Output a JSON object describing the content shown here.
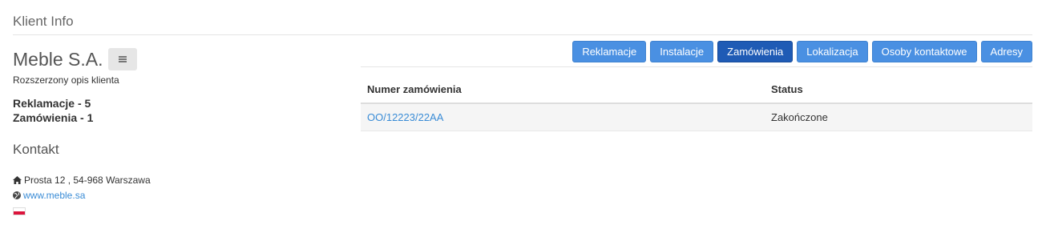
{
  "page": {
    "title": "Klient Info"
  },
  "client": {
    "name": "Meble S.A.",
    "description": "Rozszerzony opis klienta",
    "complaints_count": "Reklamacje - 5",
    "orders_count": "Zamówienia - 1"
  },
  "contact": {
    "heading": "Kontakt",
    "address": "Prosta 12 , 54-968 Warszawa",
    "website": "www.meble.sa",
    "country_flag": "poland-flag-icon"
  },
  "tabs": [
    {
      "label": "Reklamacje",
      "active": false
    },
    {
      "label": "Instalacje",
      "active": false
    },
    {
      "label": "Zamówienia",
      "active": true
    },
    {
      "label": "Lokalizacja",
      "active": false
    },
    {
      "label": "Osoby kontaktowe",
      "active": false
    },
    {
      "label": "Adresy",
      "active": false
    }
  ],
  "orders_table": {
    "headers": [
      "Numer zamówienia",
      "Status"
    ],
    "rows": [
      {
        "number": "OO/12223/22AA",
        "status": "Zakończone"
      }
    ]
  },
  "colors": {
    "tab": "#4a90e2",
    "tab_active": "#1f5bb5",
    "link": "#3a8cd6"
  }
}
